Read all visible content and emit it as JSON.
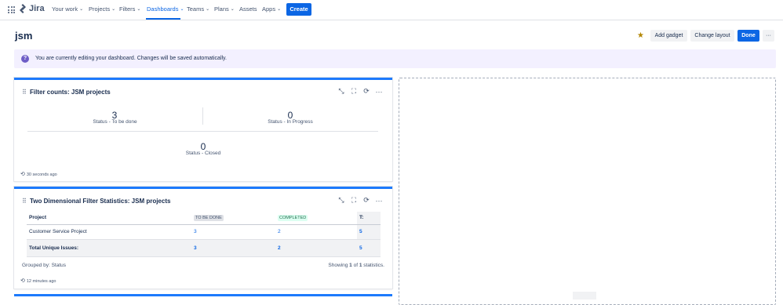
{
  "nav": {
    "logo": "Jira",
    "items": [
      "Your work",
      "Projects",
      "Filters",
      "Dashboards",
      "Teams",
      "Plans",
      "Assets",
      "Apps"
    ],
    "create": "Create"
  },
  "header": {
    "title": "jsm",
    "add_gadget": "Add gadget",
    "change_layout": "Change layout",
    "done": "Done",
    "more": "···"
  },
  "banner": {
    "text": "You are currently editing your dashboard. Changes will be saved automatically."
  },
  "filter_counts": {
    "title": "Filter counts: JSM projects",
    "stats": [
      {
        "count": "3",
        "label": "Status - To be done"
      },
      {
        "count": "0",
        "label": "Status - In Progress"
      },
      {
        "count": "0",
        "label": "Status - Closed"
      }
    ],
    "refreshed": "30 seconds ago"
  },
  "two_dim": {
    "title": "Two Dimensional Filter Statistics: JSM projects",
    "headers": [
      "Project",
      "TO BE DONE",
      "COMPLETED",
      "T:"
    ],
    "rows": [
      {
        "project": "Customer Service Project",
        "todo": "3",
        "completed": "2",
        "total": "5"
      }
    ],
    "total_row": {
      "label": "Total Unique Issues:",
      "todo": "3",
      "completed": "2",
      "total": "5"
    },
    "grouped_by": "Grouped by: Status",
    "showing_prefix": "Showing",
    "showing_a": "1",
    "showing_of": "of",
    "showing_b": "1",
    "showing_suffix": "statistics.",
    "refreshed": "12 minutes ago"
  },
  "colors": {
    "accent": "#0c66e4",
    "banner_bg": "#f3f0ff",
    "star": "#b38600"
  }
}
